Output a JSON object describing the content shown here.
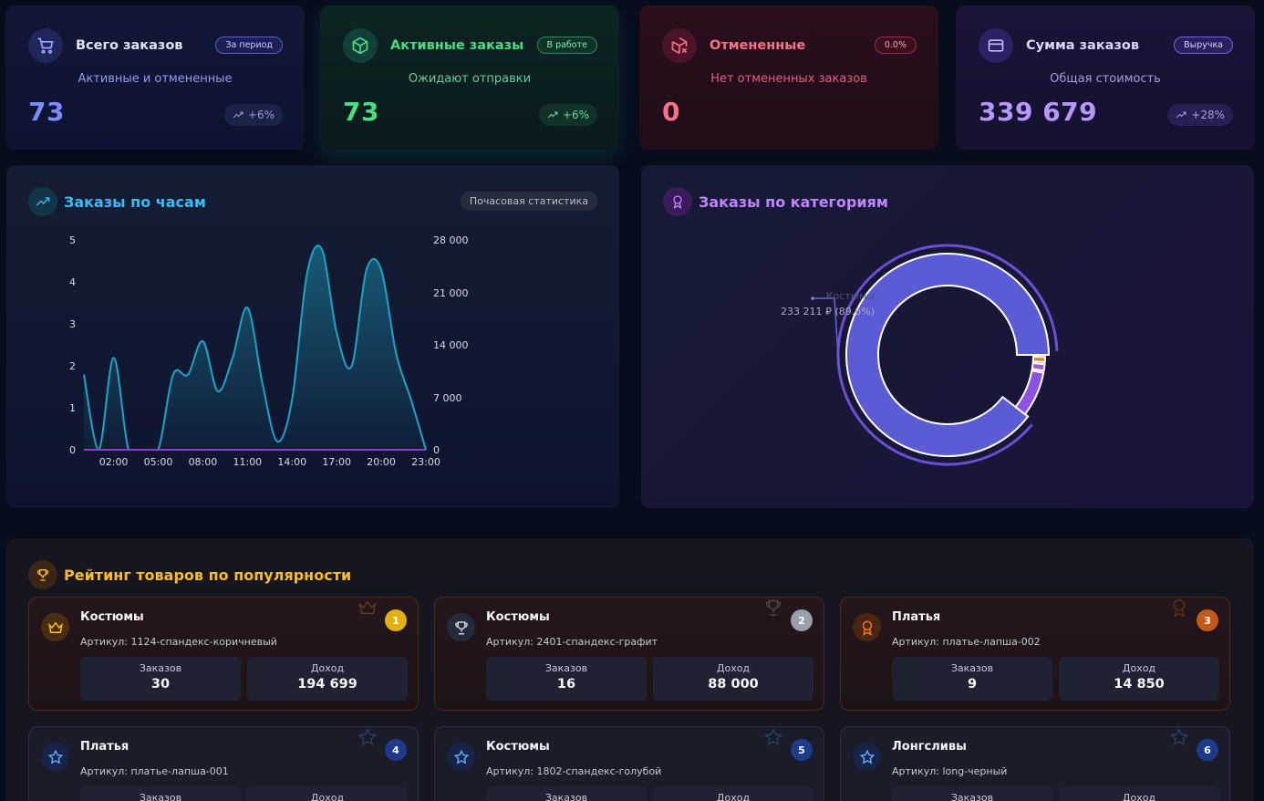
{
  "stats": {
    "total": {
      "title": "Всего заказов",
      "badge": "За период",
      "subtitle": "Активные и отмененные",
      "value": "73",
      "trend": "+6%",
      "accent": "#7c8cff"
    },
    "active": {
      "title": "Активные заказы",
      "badge": "В работе",
      "subtitle": "Ожидают отправки",
      "value": "73",
      "trend": "+6%",
      "accent": "#4ade80"
    },
    "cancelled": {
      "title": "Отмененные",
      "badge": "0.0%",
      "subtitle": "Нет отмененных заказов",
      "value": "0",
      "accent": "#fb7185"
    },
    "sum": {
      "title": "Сумма заказов",
      "badge": "Выручка",
      "subtitle": "Общая стоимость",
      "value": "339 679",
      "trend": "+28%",
      "accent": "#a78bfa"
    }
  },
  "hours_panel": {
    "title": "Заказы по часам",
    "chip": "Почасовая статистика"
  },
  "chart_data": [
    {
      "type": "area",
      "x": [
        "00:00",
        "01:00",
        "02:00",
        "03:00",
        "04:00",
        "05:00",
        "06:00",
        "07:00",
        "08:00",
        "09:00",
        "10:00",
        "11:00",
        "12:00",
        "13:00",
        "14:00",
        "15:00",
        "16:00",
        "17:00",
        "18:00",
        "19:00",
        "20:00",
        "21:00",
        "22:00",
        "23:00"
      ],
      "x_ticks": [
        "02:00",
        "05:00",
        "08:00",
        "11:00",
        "14:00",
        "17:00",
        "20:00",
        "23:00"
      ],
      "y_left_ticks": [
        "5",
        "4",
        "3",
        "2",
        "1",
        "0"
      ],
      "y_right_ticks": [
        "28 000",
        "21 000",
        "14 000",
        "7 000",
        "0"
      ],
      "ylim_left": [
        0,
        5
      ],
      "ylim_right": [
        0,
        28000
      ],
      "series": [
        {
          "axis": "left",
          "values": [
            1.8,
            0,
            2.2,
            0,
            0,
            0,
            1.8,
            1.8,
            2.6,
            1.4,
            2.2,
            3.4,
            1.6,
            0.2,
            1.2,
            4.2,
            4.8,
            2.8,
            2.0,
            4.3,
            4.3,
            2.3,
            1.2,
            0
          ]
        },
        {
          "axis": "right",
          "values": [
            0,
            0,
            0,
            0,
            0,
            0,
            0,
            0,
            0,
            0,
            0,
            0,
            0,
            0,
            0,
            0,
            0,
            0,
            0,
            0,
            0,
            0,
            0,
            0
          ]
        }
      ],
      "colors": {
        "area_stroke": "#1aa6c6",
        "baseline": "#8b3cd6"
      }
    },
    {
      "type": "pie",
      "title": "Заказы по категориям",
      "slices": [
        {
          "label": "Костюмы",
          "value": 89.6,
          "color": "#5b5bd6"
        },
        {
          "label": "",
          "value": 1.2,
          "color": "#c98a3d"
        },
        {
          "label": "",
          "value": 1.4,
          "color": "#9e5ae0"
        },
        {
          "label": "",
          "value": 7.8,
          "color": "#8c52e6"
        }
      ],
      "callout": {
        "label": "Костюмы",
        "value": "233 211 ₽ (89.6%)"
      }
    }
  ],
  "rating": {
    "title": "Рейтинг товаров по популярности",
    "orders_label": "Заказов",
    "revenue_label": "Доход",
    "items": [
      {
        "rank": "1",
        "name": "Костюмы",
        "sku": "Артикул: 1124-спандекс-коричневый",
        "orders": "30",
        "revenue": "194 699",
        "icon": "crown-icon",
        "rank_color": "#e3b012"
      },
      {
        "rank": "2",
        "name": "Костюмы",
        "sku": "Артикул: 2401-спандекс-графит",
        "orders": "16",
        "revenue": "88 000",
        "icon": "trophy-icon",
        "rank_color": "#9aa0ab"
      },
      {
        "rank": "3",
        "name": "Платья",
        "sku": "Артикул: платье-лапша-002",
        "orders": "9",
        "revenue": "14 850",
        "icon": "medal-icon",
        "rank_color": "#c45a16"
      },
      {
        "rank": "4",
        "name": "Платья",
        "sku": "Артикул: платье-лапша-001",
        "orders": "",
        "revenue": "",
        "icon": "star-icon",
        "rank_color": "#1e3a8a"
      },
      {
        "rank": "5",
        "name": "Костюмы",
        "sku": "Артикул: 1802-спандекс-голубой",
        "orders": "",
        "revenue": "",
        "icon": "star-icon",
        "rank_color": "#1e3a8a"
      },
      {
        "rank": "6",
        "name": "Лонгсливы",
        "sku": "Артикул: long-черный",
        "orders": "",
        "revenue": "",
        "icon": "star-icon",
        "rank_color": "#1e3a8a"
      }
    ]
  }
}
